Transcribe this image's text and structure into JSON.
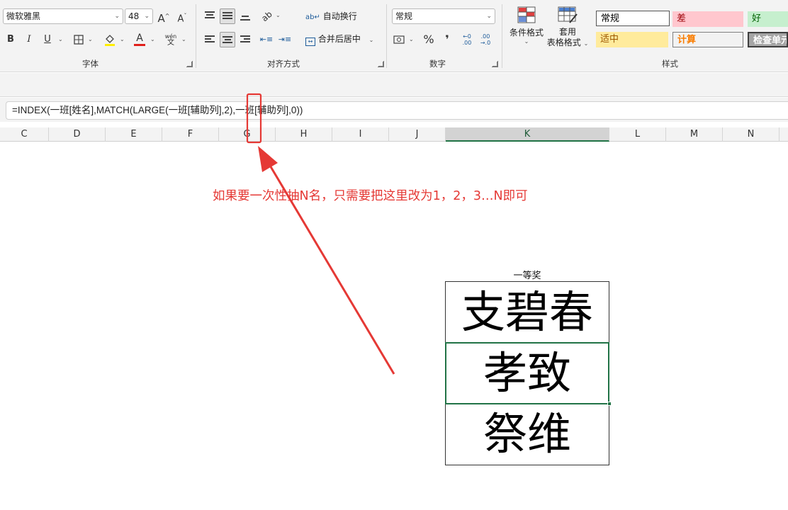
{
  "ribbon": {
    "font": {
      "name": "微软雅黑",
      "size": "48",
      "bold": "B",
      "italic": "I",
      "underline": "U",
      "label": "字体"
    },
    "alignment": {
      "wrap_text": "自动换行",
      "merge_center": "合并后居中",
      "label": "对齐方式"
    },
    "number": {
      "format": "常规",
      "percent": "%",
      "comma": "❜",
      "inc_decimal": ".00",
      "dec_decimal": ".0",
      "label": "数字"
    },
    "styles": {
      "conditional_format": "条件格式",
      "table_format_line1": "套用",
      "table_format_line2": "表格格式",
      "cells": [
        "常规",
        "差",
        "好",
        "适中",
        "计算",
        "检查单元"
      ],
      "label": "样式"
    }
  },
  "formula": {
    "text": "=INDEX(一班[姓名],MATCH(LARGE(一班[辅助列],2),一班[辅助列],0))"
  },
  "columns": [
    "C",
    "D",
    "E",
    "F",
    "G",
    "H",
    "I",
    "J",
    "K",
    "L",
    "M",
    "N"
  ],
  "selected_column": "K",
  "annotation": {
    "text": "如果要一次性抽N名，只需要把这里改为1，2，3…N即可",
    "color": "#e53935"
  },
  "prize": {
    "title": "一等奖",
    "names": [
      "支碧春",
      "孝致",
      "祭维"
    ],
    "active_index": 1
  },
  "colors": {
    "accent_green": "#217346",
    "style_bad_bg": "#ffc7ce",
    "style_good_bg": "#c6efce",
    "style_neutral_bg": "#ffeb9c",
    "style_calc_bg": "#f2f2f2",
    "style_check_bg": "#a5a5a5"
  }
}
